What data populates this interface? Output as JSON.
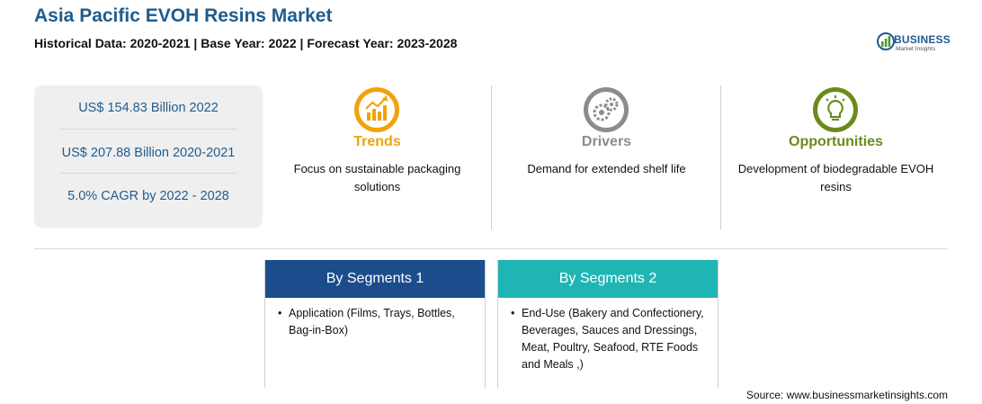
{
  "header": {
    "title": "Asia Pacific EVOH Resins Market",
    "subtitle": "Historical Data: 2020-2021 | Base Year: 2022 | Forecast Year: 2023-2028"
  },
  "logo": {
    "name": "BUSINESS",
    "tagline": "Market Insights",
    "icon": "logo-globe-icon"
  },
  "stats": [
    "US$ 154.83 Billion 2022",
    "US$ 207.88 Billion 2020-2021",
    "5.0% CAGR by 2022 - 2028"
  ],
  "highlights": [
    {
      "title": "Trends",
      "text": "Focus on sustainable packaging solutions",
      "icon": "trend-chart-icon",
      "color": "#f0a30a"
    },
    {
      "title": "Drivers",
      "text": "Demand for extended shelf life",
      "icon": "gears-icon",
      "color": "#8c8c8c"
    },
    {
      "title": "Opportunities",
      "text": "Development of biodegradable EVOH resins",
      "icon": "lightbulb-icon",
      "color": "#6b8a1c"
    }
  ],
  "segments": [
    {
      "title": "By Segments 1",
      "bullet": "•",
      "item": "Application (Films, Trays, Bottles, Bag-in-Box)",
      "color": "#1b4d8c"
    },
    {
      "title": "By Segments 2",
      "bullet": "•",
      "item": "End-Use (Bakery and Confectionery, Beverages, Sauces and Dressings, Meat, Poultry, Seafood, RTE Foods and Meals ,)",
      "color": "#1fb5b5"
    }
  ],
  "source": "Source: www.businessmarketinsights.com"
}
